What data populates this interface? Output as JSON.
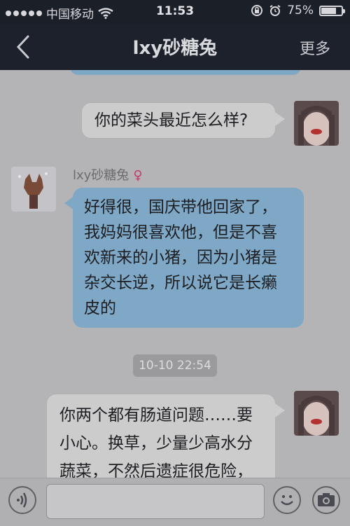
{
  "status_bar": {
    "carrier": "中国移动",
    "time": "11:53",
    "battery": "75%",
    "battery_level": 0.75
  },
  "nav": {
    "title": "lxy砂糖兔",
    "more_label": "更多"
  },
  "messages": [
    {
      "side": "right",
      "text": "你的菜头最近怎么样?"
    },
    {
      "side": "left",
      "sender": "lxy砂糖兔",
      "gender_symbol": "♀",
      "lines": [
        "好得很，国庆带他回家了，",
        "我妈妈很喜欢他，但是不喜",
        "欢新来的小猪，因为小猪是",
        "杂交长逆，所以说它是长癞",
        "皮的"
      ]
    },
    {
      "type": "timestamp",
      "text": "10-10 22:54"
    },
    {
      "side": "right",
      "lines": [
        "你两个都有肠道问题……要",
        "小心。换草，少量少高水分",
        "蔬菜，不然后遗症很危险，"
      ]
    }
  ],
  "input": {
    "value": "",
    "placeholder": ""
  },
  "icons": {
    "voice": "voice-icon",
    "emoji": "smiley-icon",
    "camera": "camera-icon"
  },
  "colors": {
    "nav_bg": "#1d212b",
    "incoming_bubble": "#7ea8c6",
    "outgoing_bubble": "#cdcccd"
  }
}
